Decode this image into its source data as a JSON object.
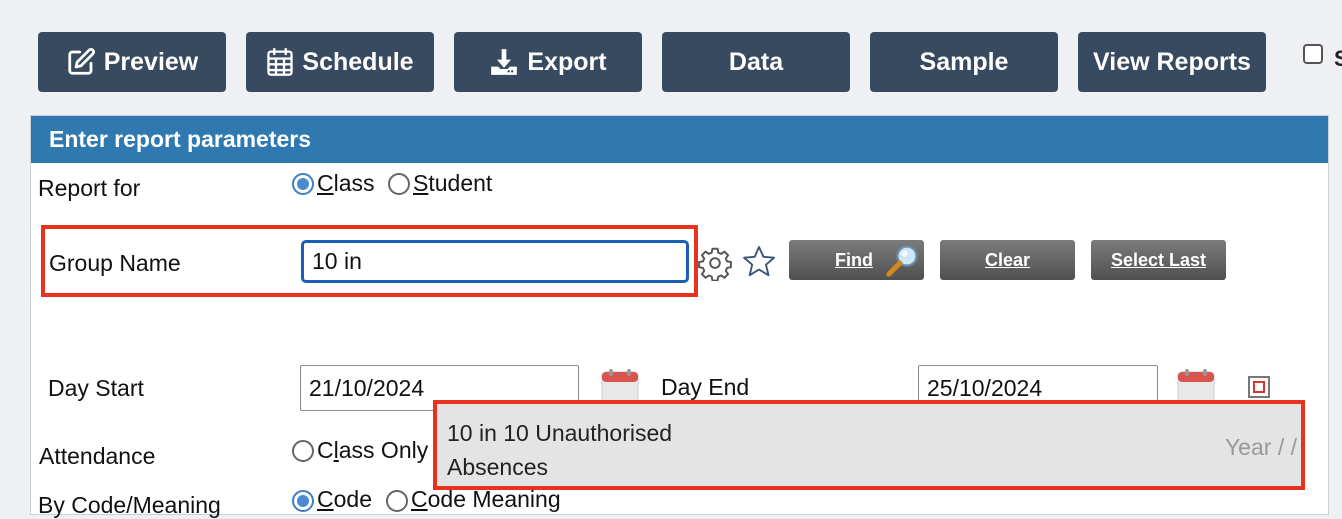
{
  "toolbar": {
    "preview_label": "Preview",
    "schedule_label": "Schedule",
    "export_label": "Export",
    "data_label": "Data",
    "sample_label": "Sample",
    "view_reports_label": "View Reports",
    "checkbox_label": "S",
    "button_color": "#374a5f"
  },
  "panel": {
    "header": "Enter report parameters",
    "header_color": "#2f79b0"
  },
  "report_for": {
    "label": "Report for",
    "options": [
      {
        "prefix": "",
        "underline": "C",
        "rest": "lass",
        "selected": true
      },
      {
        "prefix": "",
        "underline": "S",
        "rest": "tudent",
        "selected": false
      }
    ]
  },
  "group_name": {
    "label": "Group Name",
    "value": "10 in",
    "find_label": "Find",
    "clear_label": "Clear",
    "select_last_label": "Select Last",
    "settings_icon": "gear-icon",
    "favourite_icon": "star-icon"
  },
  "day_start": {
    "label": "Day Start",
    "value": "21/10/2024"
  },
  "day_end": {
    "label": "Day End",
    "value": "25/10/2024"
  },
  "attendance": {
    "label": "Attendance",
    "option_prefix": "C",
    "option_underline": "l",
    "option_rest": "ass Only"
  },
  "by_code": {
    "label": "By Code/Meaning",
    "option1_underline": "C",
    "option1_rest": "ode",
    "option2_underline": "C",
    "option2_rest": "ode Meaning"
  },
  "autocomplete": {
    "item_text": "10 in 10 Unauthorised Absences",
    "item_suffix": "Year / /"
  },
  "colors": {
    "highlight": "#e8321e",
    "focus_border": "#1a5fb4"
  }
}
